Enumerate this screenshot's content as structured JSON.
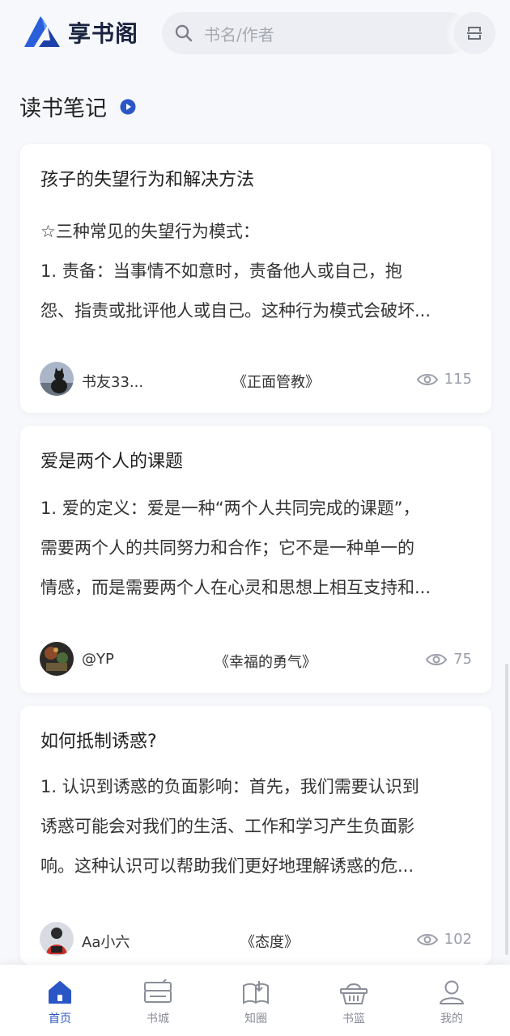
{
  "app": {
    "name": "享书阁",
    "logo_icon": "triangle-logo-icon"
  },
  "search": {
    "placeholder": "书名/作者"
  },
  "section": {
    "title": "读书笔记"
  },
  "notes": [
    {
      "title": "孩子的失望行为和解决方法",
      "excerpt_lines": [
        "☆三种常见的失望行为模式：",
        "1. 责备：当事情不如意时，责备他人或自己，抱",
        "怨、指责或批评他人或自己。这种行为模式会破坏..."
      ],
      "author": "书友33...",
      "book": "《正面管教》",
      "views": "115"
    },
    {
      "title": "爱是两个人的课题",
      "excerpt_lines": [
        "1. 爱的定义：爱是一种“两个人共同完成的课题”，",
        "需要两个人的共同努力和合作；它不是一种单一的",
        "情感，而是需要两个人在心灵和思想上相互支持和..."
      ],
      "author": "@YP",
      "book": "《幸福的勇气》",
      "views": "75"
    },
    {
      "title": "如何抵制诱惑?",
      "excerpt_lines": [
        "1. 认识到诱惑的负面影响：首先，我们需要认识到",
        "诱惑可能会对我们的生活、工作和学习产生负面影",
        "响。这种认识可以帮助我们更好地理解诱惑的危..."
      ],
      "author": "Aa小六",
      "book": "《态度》",
      "views": "102"
    }
  ],
  "tabs": [
    {
      "label": "首页",
      "icon": "home-icon",
      "active": true
    },
    {
      "label": "书城",
      "icon": "bookstore-icon",
      "active": false
    },
    {
      "label": "知圈",
      "icon": "circle-book-icon",
      "active": false
    },
    {
      "label": "书篮",
      "icon": "basket-icon",
      "active": false
    },
    {
      "label": "我的",
      "icon": "user-icon",
      "active": false
    }
  ],
  "colors": {
    "accent": "#2a56c6",
    "background": "#f7f8fb",
    "text": "#222222",
    "muted": "#9a9ea8"
  }
}
